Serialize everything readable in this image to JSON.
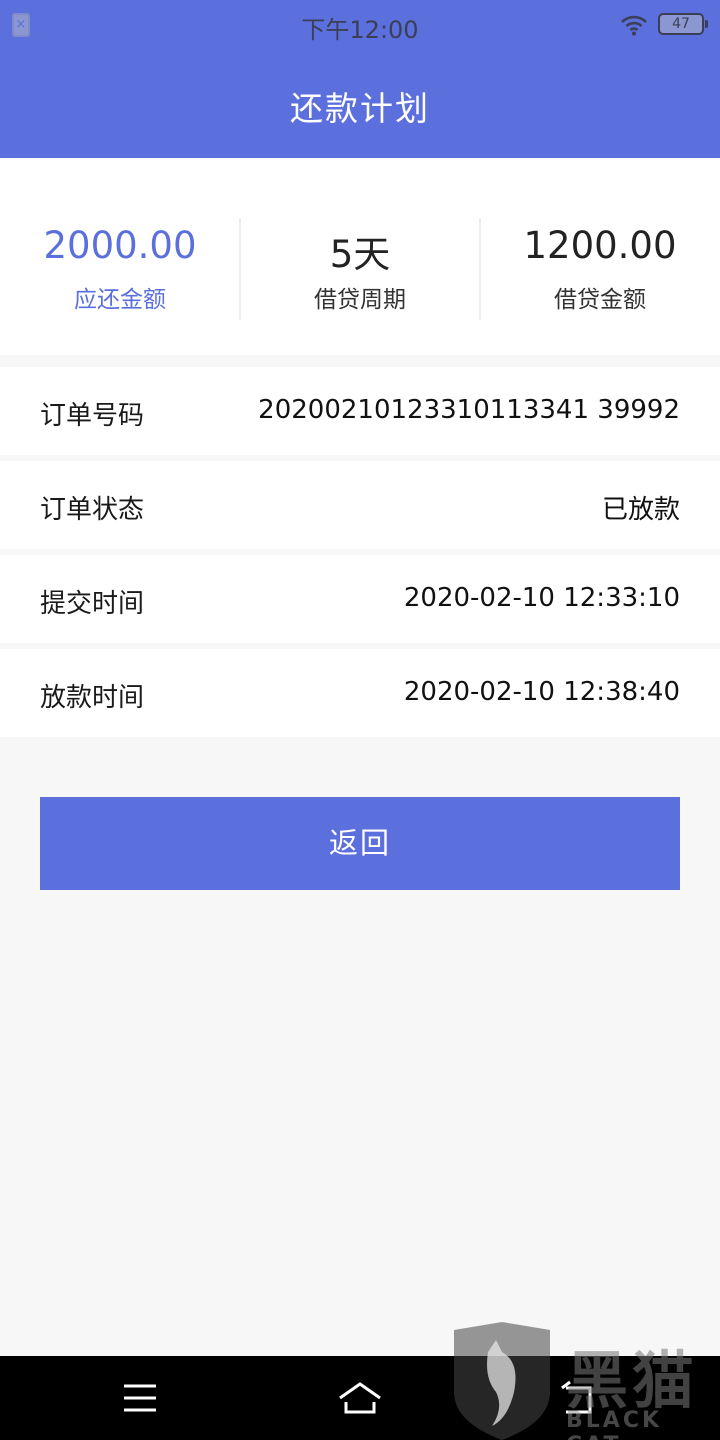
{
  "status_bar": {
    "time": "下午12:00",
    "battery": "47",
    "sim_icon_glyph": "×"
  },
  "header": {
    "title": "还款计划"
  },
  "summary": [
    {
      "value": "2000.00",
      "label": "应还金额"
    },
    {
      "value": "5天",
      "label": "借贷周期"
    },
    {
      "value": "1200.00",
      "label": "借贷金额"
    }
  ],
  "details": [
    {
      "key": "订单号码",
      "value": "20200210123310113341 39992"
    },
    {
      "key": "订单状态",
      "value": "已放款"
    },
    {
      "key": "提交时间",
      "value": "2020-02-10 12:33:10"
    },
    {
      "key": "放款时间",
      "value": "2020-02-10 12:38:40"
    }
  ],
  "back_button": {
    "label": "返回"
  },
  "watermark": {
    "text": "黑猫",
    "subtext": "BLACK CAT"
  },
  "colors": {
    "accent": "#5b6fdd",
    "background": "#f7f7f7"
  }
}
